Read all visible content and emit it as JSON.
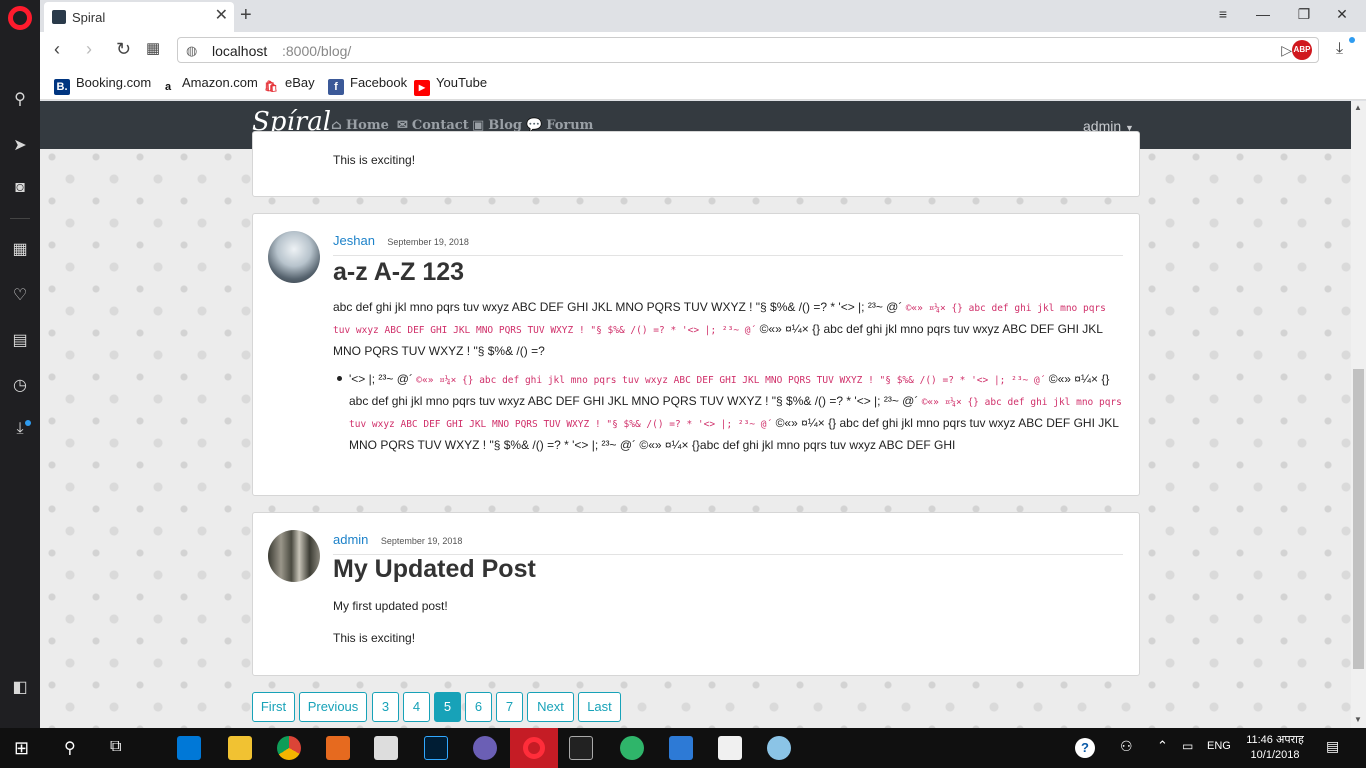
{
  "browser": {
    "tab_title": "Spiral",
    "url_host": "localhost",
    "url_rest": ":8000/blog/",
    "abp_label": "ABP",
    "bookmarks": [
      {
        "label": "Booking.com",
        "icon": "booking-icon",
        "color": "#003580",
        "glyph": "B."
      },
      {
        "label": "Amazon.com",
        "icon": "amazon-icon",
        "color": "#ffffff",
        "glyph": "a"
      },
      {
        "label": "eBay",
        "icon": "ebay-icon",
        "color": "#ffffff",
        "glyph": "🛍"
      },
      {
        "label": "Facebook",
        "icon": "facebook-icon",
        "color": "#3b5998",
        "glyph": "f"
      },
      {
        "label": "YouTube",
        "icon": "youtube-icon",
        "color": "#ff0000",
        "glyph": "▶"
      }
    ]
  },
  "site": {
    "brand": "Spíral",
    "nav": [
      {
        "label": "Home",
        "icon": "home-icon"
      },
      {
        "label": "Contact",
        "icon": "envelope-icon"
      },
      {
        "label": "Blog",
        "icon": "blog-icon"
      },
      {
        "label": "Forum",
        "icon": "comments-icon"
      }
    ],
    "user": "admin"
  },
  "posts": [
    {
      "partial_text": "This is exciting!"
    },
    {
      "author": "Jeshan",
      "date": "September 19, 2018",
      "title": "a-z A-Z 123",
      "p1_a": "abc def ghi jkl mno pqrs tuv wxyz ABC DEF GHI JKL MNO PQRS TUV WXYZ ! \"§ $%& /() =? * '<> |; ²³~ @´ ",
      "p1_code": "©«» ¤¼× {} abc def ghi jkl mno pqrs tuv wxyz ABC DEF GHI JKL MNO PQRS TUV WXYZ ! \"§ $%& /() =? * '<> |; ²³~ @´",
      "p1_b": " ©«» ¤¼× {} abc def ghi jkl mno pqrs tuv wxyz ABC DEF GHI JKL MNO PQRS TUV WXYZ ! \"§ $%& /() =?",
      "li_a": "'<> |; ²³~ @´ ",
      "li_code1": "©«» ¤¼× {} abc def ghi jkl mno pqrs tuv wxyz ABC DEF GHI JKL MNO PQRS TUV WXYZ ! \"§ $%& /() =? * '<> |; ²³~ @´",
      "li_b": " ©«» ¤¼× {} abc def ghi jkl mno pqrs tuv wxyz ABC DEF GHI JKL MNO PQRS TUV WXYZ ! \"§ $%& /() =? * '<> |; ²³~ @´ ",
      "li_code2": "©«» ¤¼× {} abc def ghi jkl mno pqrs tuv wxyz ABC DEF GHI JKL MNO PQRS TUV WXYZ ! \"§ $%& /() =? * '<> |; ²³~ @´",
      "li_c": " ©«» ¤¼× {} abc def ghi jkl mno pqrs tuv wxyz ABC DEF GHI JKL MNO PQRS TUV WXYZ ! \"§ $%& /() =? * '<> |; ²³~ @´ ©«» ¤¼× {}abc def ghi jkl mno pqrs tuv wxyz ABC DEF GHI"
    },
    {
      "author": "admin",
      "date": "September 19, 2018",
      "title": "My Updated Post",
      "p1": "My first updated post!",
      "p2": "This is exciting!"
    }
  ],
  "pagination": [
    "First",
    "Previous",
    "3",
    "4",
    "5",
    "6",
    "7",
    "Next",
    "Last"
  ],
  "pagination_active": "5",
  "taskbar": {
    "lang": "ENG",
    "time": "11:46 अपराह",
    "date": "10/1/2018"
  },
  "colors": {
    "accent": "#17a2b8",
    "navbar": "#343a40",
    "link": "#1d82c9",
    "code": "#d0306a"
  }
}
